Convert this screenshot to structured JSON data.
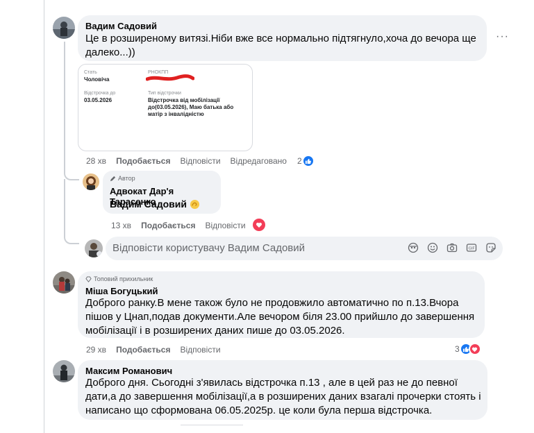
{
  "comments": [
    {
      "author": "Вадим Садовий",
      "text": "Це в розширеному витязі.Ніби вже все нормально підтягнуло,хоча до вечора ще далеко...))",
      "time": "28 хв",
      "like": "Подобається",
      "reply": "Відповісти",
      "edited": "Відредаговано",
      "reaction_count": "2",
      "card": {
        "stat_label": "Стать",
        "stat_value": "Чоловіча",
        "rnokpp_label": "РНОКПП",
        "deferral_label": "Відстрочка до",
        "deferral_value": "03.05.2026",
        "type_label": "Тип відстрочки",
        "type_value": "Відстрочка від мобілізації до(03.05.2026), Маю батька або матір з інвалідністю"
      }
    },
    {
      "badge": "Автор",
      "author": "Адвокат Дар'я Тарасенко",
      "text": "Вадим Садовий",
      "time": "13 хв",
      "like": "Подобається",
      "reply": "Відповісти"
    },
    {
      "badge": "Топовий прихильник",
      "author": "Міша Богуцький",
      "text": "Доброго ранку.В мене також було не продовжило автоматично по п.13.Вчора пішов у Цнап,подав документи.Але вечором біля 23.00 прийшло до завершення мобілізації і в розширених даних пише до 03.05.2026.",
      "time": "29 хв",
      "like": "Подобається",
      "reply": "Відповісти",
      "reaction_count": "3"
    },
    {
      "author": "Максим Романович",
      "text": "Доброго дня. Сьогодні з'явилась відстрочка п.13 , але в цей раз не до певної дати,а до завершення мобілізації,а в розширених даних взагалі прочерки стоять і написано що сформована 06.05.2025р. це коли була перша відстрочка."
    }
  ],
  "reply_box": {
    "placeholder": "Відповісти користувачу Вадим Садовий"
  },
  "more_label": "···",
  "colors": {
    "bubble": "#f0f2f5",
    "like_blue": "#1877f2",
    "love_red": "#f33e58",
    "meta_gray": "#65676b"
  }
}
